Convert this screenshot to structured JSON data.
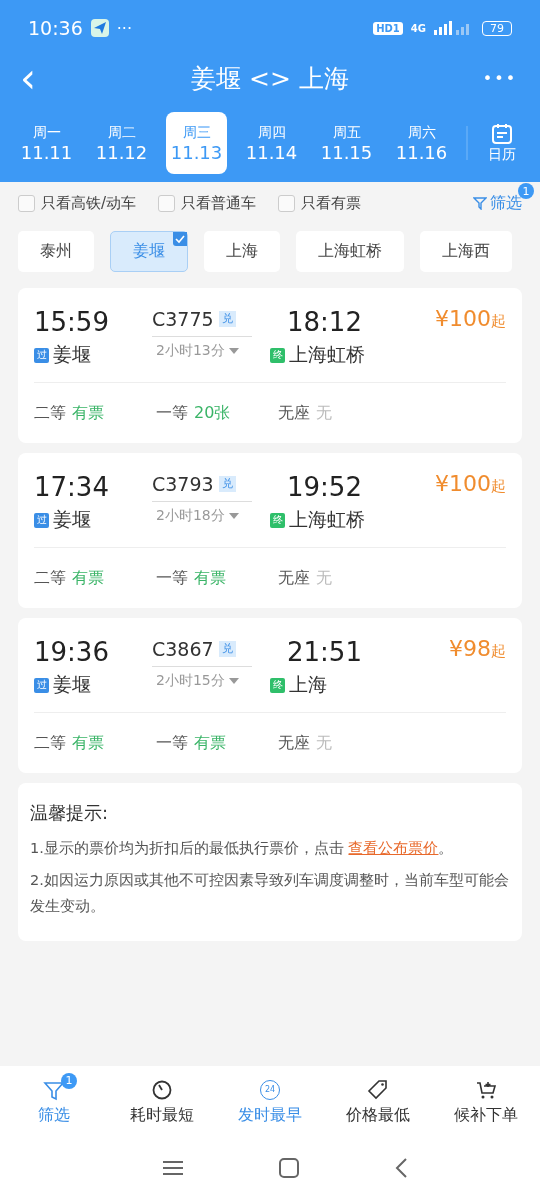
{
  "status_bar": {
    "time": "10:36",
    "dots": "···",
    "hd": "HD1",
    "network": "4G",
    "battery": "79"
  },
  "header": {
    "back": "‹",
    "title": "姜堰 <> 上海",
    "more": "•••"
  },
  "dates": [
    {
      "weekday": "周一",
      "date": "11.11",
      "selected": false
    },
    {
      "weekday": "周二",
      "date": "11.12",
      "selected": false
    },
    {
      "weekday": "周三",
      "date": "11.13",
      "selected": true
    },
    {
      "weekday": "周四",
      "date": "11.14",
      "selected": false
    },
    {
      "weekday": "周五",
      "date": "11.15",
      "selected": false
    },
    {
      "weekday": "周六",
      "date": "11.16",
      "selected": false
    }
  ],
  "calendar": {
    "label": "日历"
  },
  "filters": [
    {
      "label": "只看高铁/动车",
      "checked": false
    },
    {
      "label": "只看普通车",
      "checked": false
    },
    {
      "label": "只看有票",
      "checked": false
    }
  ],
  "filter_button": {
    "label": "筛选",
    "badge": "1"
  },
  "stations": [
    {
      "label": "泰州",
      "selected": false
    },
    {
      "label": "姜堰",
      "selected": true
    },
    {
      "label": "上海",
      "selected": false
    },
    {
      "label": "上海虹桥",
      "selected": false
    },
    {
      "label": "上海西",
      "selected": false
    }
  ],
  "trains": [
    {
      "depart": "15:59",
      "number": "C3775",
      "tag": "兑",
      "arrive": "18:12",
      "price": "¥100",
      "price_suffix": "起",
      "duration": "2小时13分",
      "from": {
        "mark": "过",
        "name": "姜堰",
        "color": "#3a8ee6"
      },
      "to": {
        "mark": "终",
        "name": "上海虹桥",
        "color": "#2fbf6a"
      },
      "seats": [
        {
          "class": "二等",
          "status": "有票",
          "available": true
        },
        {
          "class": "一等",
          "status": "20张",
          "available": true
        },
        {
          "class": "无座",
          "status": "无",
          "available": false
        }
      ]
    },
    {
      "depart": "17:34",
      "number": "C3793",
      "tag": "兑",
      "arrive": "19:52",
      "price": "¥100",
      "price_suffix": "起",
      "duration": "2小时18分",
      "from": {
        "mark": "过",
        "name": "姜堰",
        "color": "#3a8ee6"
      },
      "to": {
        "mark": "终",
        "name": "上海虹桥",
        "color": "#2fbf6a"
      },
      "seats": [
        {
          "class": "二等",
          "status": "有票",
          "available": true
        },
        {
          "class": "一等",
          "status": "有票",
          "available": true
        },
        {
          "class": "无座",
          "status": "无",
          "available": false
        }
      ]
    },
    {
      "depart": "19:36",
      "number": "C3867",
      "tag": "兑",
      "arrive": "21:51",
      "price": "¥98",
      "price_suffix": "起",
      "duration": "2小时15分",
      "from": {
        "mark": "过",
        "name": "姜堰",
        "color": "#3a8ee6"
      },
      "to": {
        "mark": "终",
        "name": "上海",
        "color": "#2fbf6a"
      },
      "seats": [
        {
          "class": "二等",
          "status": "有票",
          "available": true
        },
        {
          "class": "一等",
          "status": "有票",
          "available": true
        },
        {
          "class": "无座",
          "status": "无",
          "available": false
        }
      ]
    }
  ],
  "tips": {
    "title": "温馨提示:",
    "line1": "1.显示的票价均为折扣后的最低执行票价，点击",
    "link": "查看公布票价",
    "line1_end": "。",
    "line2": "2.如因运力原因或其他不可控因素导致列车调度调整时，当前车型可能会发生变动。"
  },
  "bottom_tabs": [
    {
      "kind": "filter",
      "label": "筛选",
      "badge": "1",
      "selected": true
    },
    {
      "kind": "timer",
      "label": "耗时最短",
      "selected": false
    },
    {
      "kind": "clock24",
      "label": "发时最早",
      "icon_text": "24",
      "selected": true
    },
    {
      "kind": "tag",
      "label": "价格最低",
      "selected": false
    },
    {
      "kind": "cart",
      "label": "候补下单",
      "selected": false
    }
  ]
}
